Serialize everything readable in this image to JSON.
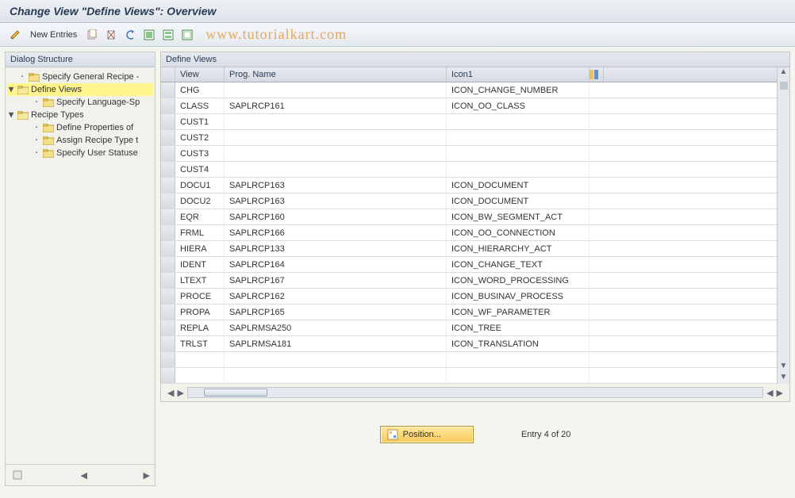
{
  "title": "Change View \"Define Views\": Overview",
  "toolbar": {
    "new_entries": "New Entries",
    "watermark": "www.tutorialkart.com"
  },
  "sidebar": {
    "title": "Dialog Structure",
    "items": [
      {
        "label": "Specify General Recipe -",
        "expander": "",
        "indent": 1,
        "open": false,
        "selected": false
      },
      {
        "label": "Define Views",
        "expander": "▼",
        "indent": 0,
        "open": true,
        "selected": true
      },
      {
        "label": "Specify Language-Sp",
        "expander": "·",
        "indent": 2,
        "open": false,
        "selected": false
      },
      {
        "label": "Recipe Types",
        "expander": "▼",
        "indent": 0,
        "open": true,
        "selected": false
      },
      {
        "label": "Define Properties of",
        "expander": "·",
        "indent": 2,
        "open": false,
        "selected": false
      },
      {
        "label": "Assign Recipe Type t",
        "expander": "·",
        "indent": 2,
        "open": false,
        "selected": false
      },
      {
        "label": "Specify User Statuse",
        "expander": "·",
        "indent": 2,
        "open": false,
        "selected": false
      }
    ]
  },
  "panel": {
    "title": "Define Views",
    "columns": {
      "view": "View",
      "prog": "Prog. Name",
      "icon": "Icon1"
    },
    "rows": [
      {
        "view": "CHG",
        "prog": "",
        "icon": "ICON_CHANGE_NUMBER"
      },
      {
        "view": "CLASS",
        "prog": "SAPLRCP161",
        "icon": "ICON_OO_CLASS"
      },
      {
        "view": "CUST1",
        "prog": "",
        "icon": ""
      },
      {
        "view": "CUST2",
        "prog": "",
        "icon": ""
      },
      {
        "view": "CUST3",
        "prog": "",
        "icon": ""
      },
      {
        "view": "CUST4",
        "prog": "",
        "icon": ""
      },
      {
        "view": "DOCU1",
        "prog": "SAPLRCP163",
        "icon": "ICON_DOCUMENT"
      },
      {
        "view": "DOCU2",
        "prog": "SAPLRCP163",
        "icon": "ICON_DOCUMENT"
      },
      {
        "view": "EQR",
        "prog": "SAPLRCP160",
        "icon": "ICON_BW_SEGMENT_ACT"
      },
      {
        "view": "FRML",
        "prog": "SAPLRCP166",
        "icon": "ICON_OO_CONNECTION"
      },
      {
        "view": "HIERA",
        "prog": "SAPLRCP133",
        "icon": "ICON_HIERARCHY_ACT"
      },
      {
        "view": "IDENT",
        "prog": "SAPLRCP164",
        "icon": "ICON_CHANGE_TEXT"
      },
      {
        "view": "LTEXT",
        "prog": "SAPLRCP167",
        "icon": "ICON_WORD_PROCESSING"
      },
      {
        "view": "PROCE",
        "prog": "SAPLRCP162",
        "icon": "ICON_BUSINAV_PROCESS"
      },
      {
        "view": "PROPA",
        "prog": "SAPLRCP165",
        "icon": "ICON_WF_PARAMETER"
      },
      {
        "view": "REPLA",
        "prog": "SAPLRMSA250",
        "icon": "ICON_TREE"
      },
      {
        "view": "TRLST",
        "prog": "SAPLRMSA181",
        "icon": "ICON_TRANSLATION"
      },
      {
        "view": "",
        "prog": "",
        "icon": ""
      },
      {
        "view": "",
        "prog": "",
        "icon": ""
      }
    ]
  },
  "footer": {
    "position_btn": "Position...",
    "entry_status": "Entry 4 of 20"
  }
}
